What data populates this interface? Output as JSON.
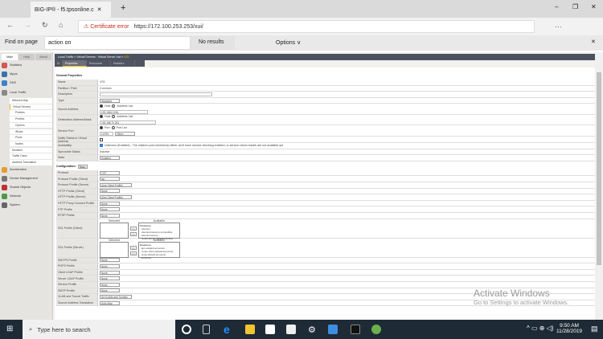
{
  "browser": {
    "tab_title": "BIG-IP® - f5.tpsonline.c",
    "cert_error": "Certificate error",
    "url": "https://172.100.253.253/xui/",
    "find_label": "Find on page",
    "find_value": "action on",
    "find_result": "No results",
    "options": "Options ∨"
  },
  "sidebar": {
    "tabs": [
      "Main",
      "Help",
      "About"
    ],
    "top_items": [
      {
        "label": "Statistics",
        "color": "#d9534f"
      },
      {
        "label": "iApps",
        "color": "#3b6fb0"
      },
      {
        "label": "DNS",
        "color": "#3a84c9"
      },
      {
        "label": "Local Traffic",
        "color": "#888888"
      }
    ],
    "sub_items": [
      "Network Map",
      "Virtual Servers",
      "Policies",
      "Profiles",
      "Ciphers",
      "iRules",
      "Pools",
      "Nodes",
      "Monitors",
      "Traffic Class",
      "Address Translation"
    ],
    "bottom_items": [
      {
        "label": "Acceleration",
        "color": "#e0a030"
      },
      {
        "label": "Device Management",
        "color": "#777777"
      },
      {
        "label": "Shared Objects",
        "color": "#c03030"
      },
      {
        "label": "Network",
        "color": "#4a9a4a"
      },
      {
        "label": "System",
        "color": "#666666"
      }
    ]
  },
  "breadcrumb": {
    "path": "Local Traffic  »  Virtual Servers : Virtual Server List  »  ",
    "current": "VS1"
  },
  "tabs": [
    "Properties",
    "Resources",
    "Statistics"
  ],
  "general": {
    "title": "General Properties",
    "rows": [
      {
        "label": "Name",
        "text": "VS1"
      },
      {
        "label": "Partition / Path",
        "text": "Common"
      },
      {
        "label": "Description",
        "input": ""
      },
      {
        "label": "Type",
        "select": "Standard"
      },
      {
        "label": "Source Address",
        "radio": [
          "Host",
          "Address List"
        ],
        "input": "192.168.0.0/16"
      },
      {
        "label": "Destination Address/Mask",
        "radio": [
          "Host",
          "Address List"
        ],
        "input": "192.168.70.251"
      },
      {
        "label": "Service Port",
        "radio": [
          "Port",
          "Port List"
        ],
        "input": "10799",
        "select": "Other:"
      },
      {
        "label": "Notify Status to Virtual Address",
        "checkbox": true
      },
      {
        "label": "Availability",
        "text": "Unknown (Enabled) - The children pool member(s) either don't have service checking enabled, or service check results are not available yet"
      },
      {
        "label": "Syncookie Status",
        "text": "Inactive"
      },
      {
        "label": "State",
        "select": "Enabled"
      }
    ]
  },
  "config": {
    "title": "Configuration:",
    "mode": "Basic",
    "rows": [
      {
        "label": "Protocol",
        "select": "TCP"
      },
      {
        "label": "Protocol Profile (Client)",
        "select": "tcp"
      },
      {
        "label": "Protocol Profile (Server)",
        "select": "(Use Client Profile)"
      },
      {
        "label": "HTTP Profile (Client)",
        "select": "None"
      },
      {
        "label": "HTTP Profile (Server)",
        "select": "(Use Client Profile)"
      },
      {
        "label": "HTTP Proxy Connect Profile",
        "select": "None"
      },
      {
        "label": "FTP Profile",
        "select": "None"
      },
      {
        "label": "RTSP Profile",
        "select": "None"
      },
      {
        "label": "SSL Profile (Client)",
        "listbox": {
          "selected_label": "Selected",
          "available_label": "Available",
          "available": [
            "/Common",
            "clientssl",
            "clientssl-insecure-compatible",
            "clientssl-secure",
            "crypto-server-default-clientssl"
          ]
        }
      },
      {
        "label": "SSL Profile (Server)",
        "listbox": {
          "selected_label": "Selected",
          "available_label": "Available",
          "available": [
            "/Common",
            "apm-default-serverssl",
            "crypto-client-default-serverssl",
            "pcoip-default-serverssl",
            "serverssl"
          ]
        }
      },
      {
        "label": "SMTPS Profile",
        "select": "None"
      },
      {
        "label": "POP3 Profile",
        "select": "None"
      },
      {
        "label": "Client LDAP Profile",
        "select": "None"
      },
      {
        "label": "Server LDAP Profile",
        "select": "None"
      },
      {
        "label": "Service Profile",
        "select": "None"
      },
      {
        "label": "SMTP Profile",
        "select": "None"
      },
      {
        "label": "VLAN and Tunnel Traffic",
        "select": "All VLANs and Tunnels"
      },
      {
        "label": "Source Address Translation",
        "select": "Auto Map"
      }
    ]
  },
  "watermark": {
    "title": "Activate Windows",
    "subtitle": "Go to Settings to activate Windows."
  },
  "taskbar": {
    "search": "Type here to search",
    "time": "9:50 AM",
    "date": "11/28/2019"
  }
}
